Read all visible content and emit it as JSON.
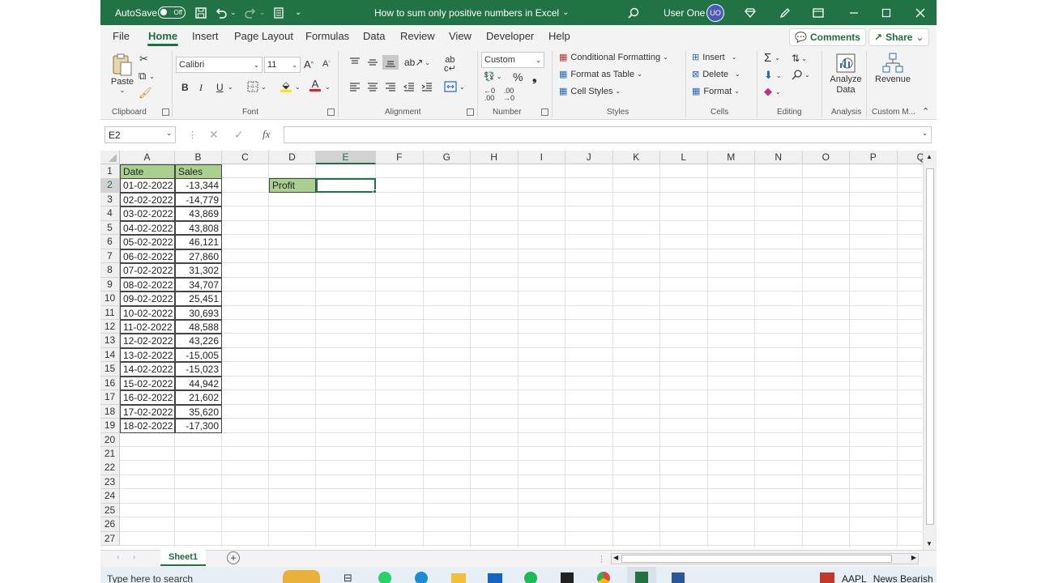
{
  "titlebar": {
    "autosave_label": "AutoSave",
    "autosave_state": "Off",
    "doc_title": "How to sum only positive numbers in Excel",
    "user_name": "User One",
    "user_initials": "UO"
  },
  "menu": {
    "tabs": [
      "File",
      "Home",
      "Insert",
      "Page Layout",
      "Formulas",
      "Data",
      "Review",
      "View",
      "Developer",
      "Help"
    ],
    "active_tab": "Home",
    "comments_label": "Comments",
    "share_label": "Share"
  },
  "ribbon": {
    "clipboard": {
      "paste": "Paste",
      "label": "Clipboard"
    },
    "font": {
      "name": "Calibri",
      "size": "11",
      "bold": "B",
      "italic": "I",
      "underline": "U",
      "label": "Font"
    },
    "alignment": {
      "label": "Alignment"
    },
    "number": {
      "format": "Custom",
      "label": "Number"
    },
    "styles": {
      "cond_format": "Conditional Formatting",
      "format_table": "Format as Table",
      "cell_styles": "Cell Styles",
      "label": "Styles"
    },
    "cells": {
      "insert": "Insert",
      "delete": "Delete",
      "format": "Format",
      "label": "Cells"
    },
    "editing": {
      "label": "Editing"
    },
    "analysis": {
      "analyze": "Analyze Data",
      "label": "Analysis"
    },
    "custom": {
      "revenue": "Revenue",
      "label": "Custom M..."
    }
  },
  "formula_bar": {
    "name_box": "E2",
    "fx": "fx",
    "value": ""
  },
  "columns": [
    "A",
    "B",
    "C",
    "D",
    "E",
    "F",
    "G",
    "H",
    "I",
    "J",
    "K",
    "L",
    "M",
    "N",
    "O",
    "P",
    "Q"
  ],
  "selected_cell": "E2",
  "headers": {
    "A": "Date",
    "B": "Sales"
  },
  "rows": [
    {
      "date": "01-02-2022",
      "sales": "-13,344"
    },
    {
      "date": "02-02-2022",
      "sales": "-14,779"
    },
    {
      "date": "03-02-2022",
      "sales": "43,869"
    },
    {
      "date": "04-02-2022",
      "sales": "43,808"
    },
    {
      "date": "05-02-2022",
      "sales": "46,121"
    },
    {
      "date": "06-02-2022",
      "sales": "27,860"
    },
    {
      "date": "07-02-2022",
      "sales": "31,302"
    },
    {
      "date": "08-02-2022",
      "sales": "34,707"
    },
    {
      "date": "09-02-2022",
      "sales": "25,451"
    },
    {
      "date": "10-02-2022",
      "sales": "30,693"
    },
    {
      "date": "11-02-2022",
      "sales": "48,588"
    },
    {
      "date": "12-02-2022",
      "sales": "43,226"
    },
    {
      "date": "13-02-2022",
      "sales": "-15,005"
    },
    {
      "date": "14-02-2022",
      "sales": "-15,023"
    },
    {
      "date": "15-02-2022",
      "sales": "44,942"
    },
    {
      "date": "16-02-2022",
      "sales": "21,602"
    },
    {
      "date": "17-02-2022",
      "sales": "35,620"
    },
    {
      "date": "18-02-2022",
      "sales": "-17,300"
    }
  ],
  "profit_label": "Profit",
  "row_count": 27,
  "sheets": [
    "Sheet1"
  ],
  "active_sheet": "Sheet1",
  "taskbar": {
    "search_placeholder": "Type here to search",
    "ticker": "AAPL",
    "news": "News Bearish"
  },
  "colors": {
    "excel_green": "#217346",
    "header_fill": "#a9d08e",
    "profit_fill": "#a9d08e"
  }
}
